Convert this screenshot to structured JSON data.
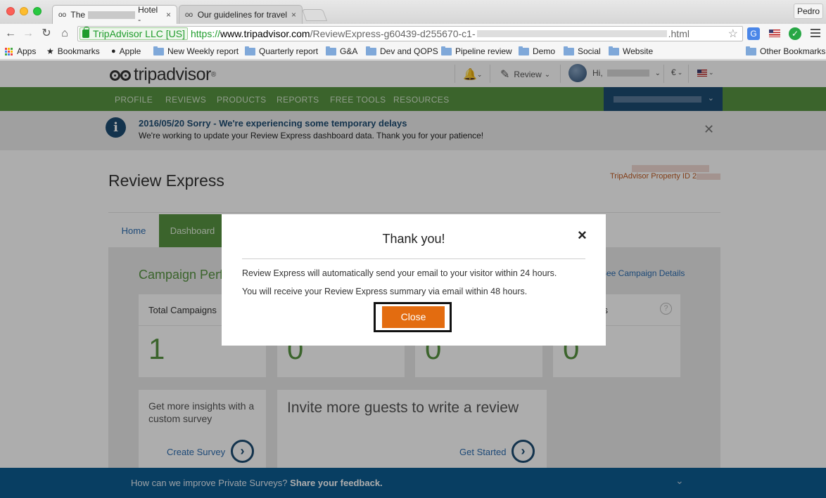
{
  "browser": {
    "tabs": [
      {
        "label_start": "The",
        "label_end": "Hotel -",
        "close": "×"
      },
      {
        "label": "Our guidelines for traveler",
        "close": "×"
      }
    ],
    "user": "Pedro",
    "ev_cert": "TripAdvisor LLC [US]",
    "url": {
      "scheme": "https://",
      "host": "www.tripadvisor.com",
      "path": "/ReviewExpress-g60439-d255670-c1-",
      "suffix": ".html"
    },
    "bookmarks": [
      "Apps",
      "Bookmarks",
      "Apple",
      "New Weekly report",
      "Quarterly report",
      "G&A",
      "Dev and QOPS",
      "Pipeline review",
      "Demo",
      "Social",
      "Website"
    ],
    "other_bookmarks": "Other Bookmarks"
  },
  "header": {
    "logo": "tripadvisor",
    "review_label": "Review",
    "greeting": "Hi,",
    "currency": "€"
  },
  "nav": {
    "items": [
      "PROFILE",
      "REVIEWS",
      "PRODUCTS",
      "REPORTS",
      "FREE TOOLS",
      "RESOURCES"
    ]
  },
  "alert": {
    "title": "2016/05/20 Sorry - We're experiencing some temporary delays",
    "message": "We're working to update your Review Express dashboard data. Thank you for your patience!"
  },
  "page": {
    "title": "Review Express",
    "property_id_label": "TripAdvisor Property ID",
    "property_id_prefix": "2"
  },
  "tabs": {
    "home": "Home",
    "dashboard": "Dashboard"
  },
  "dashboard": {
    "campaign_title": "Campaign Perfo",
    "see_details": "See Campaign Details",
    "cards": [
      {
        "label": "Total Campaigns",
        "value": "1"
      },
      {
        "label": "",
        "value": "0"
      },
      {
        "label": "",
        "value": "0"
      },
      {
        "label": "s",
        "value": "0"
      }
    ],
    "survey": {
      "text": "Get more insights with a custom survey",
      "link": "Create Survey"
    },
    "invite": {
      "text": "Invite more guests to write a review",
      "link": "Get Started"
    }
  },
  "feedback": {
    "text": "How can we improve Private Surveys?",
    "bold": "Share your feedback."
  },
  "modal": {
    "title": "Thank you!",
    "line1": "Review Express will automatically send your email to your visitor within 24 hours.",
    "line2": "You will receive your Review Express summary via email within 48 hours.",
    "close_label": "Close",
    "close_icon": "×"
  },
  "colors": {
    "brand_green": "#589442",
    "brand_navy": "#1d4c72",
    "cta_orange": "#e36c10",
    "feedback_blue": "#0d5c91"
  }
}
